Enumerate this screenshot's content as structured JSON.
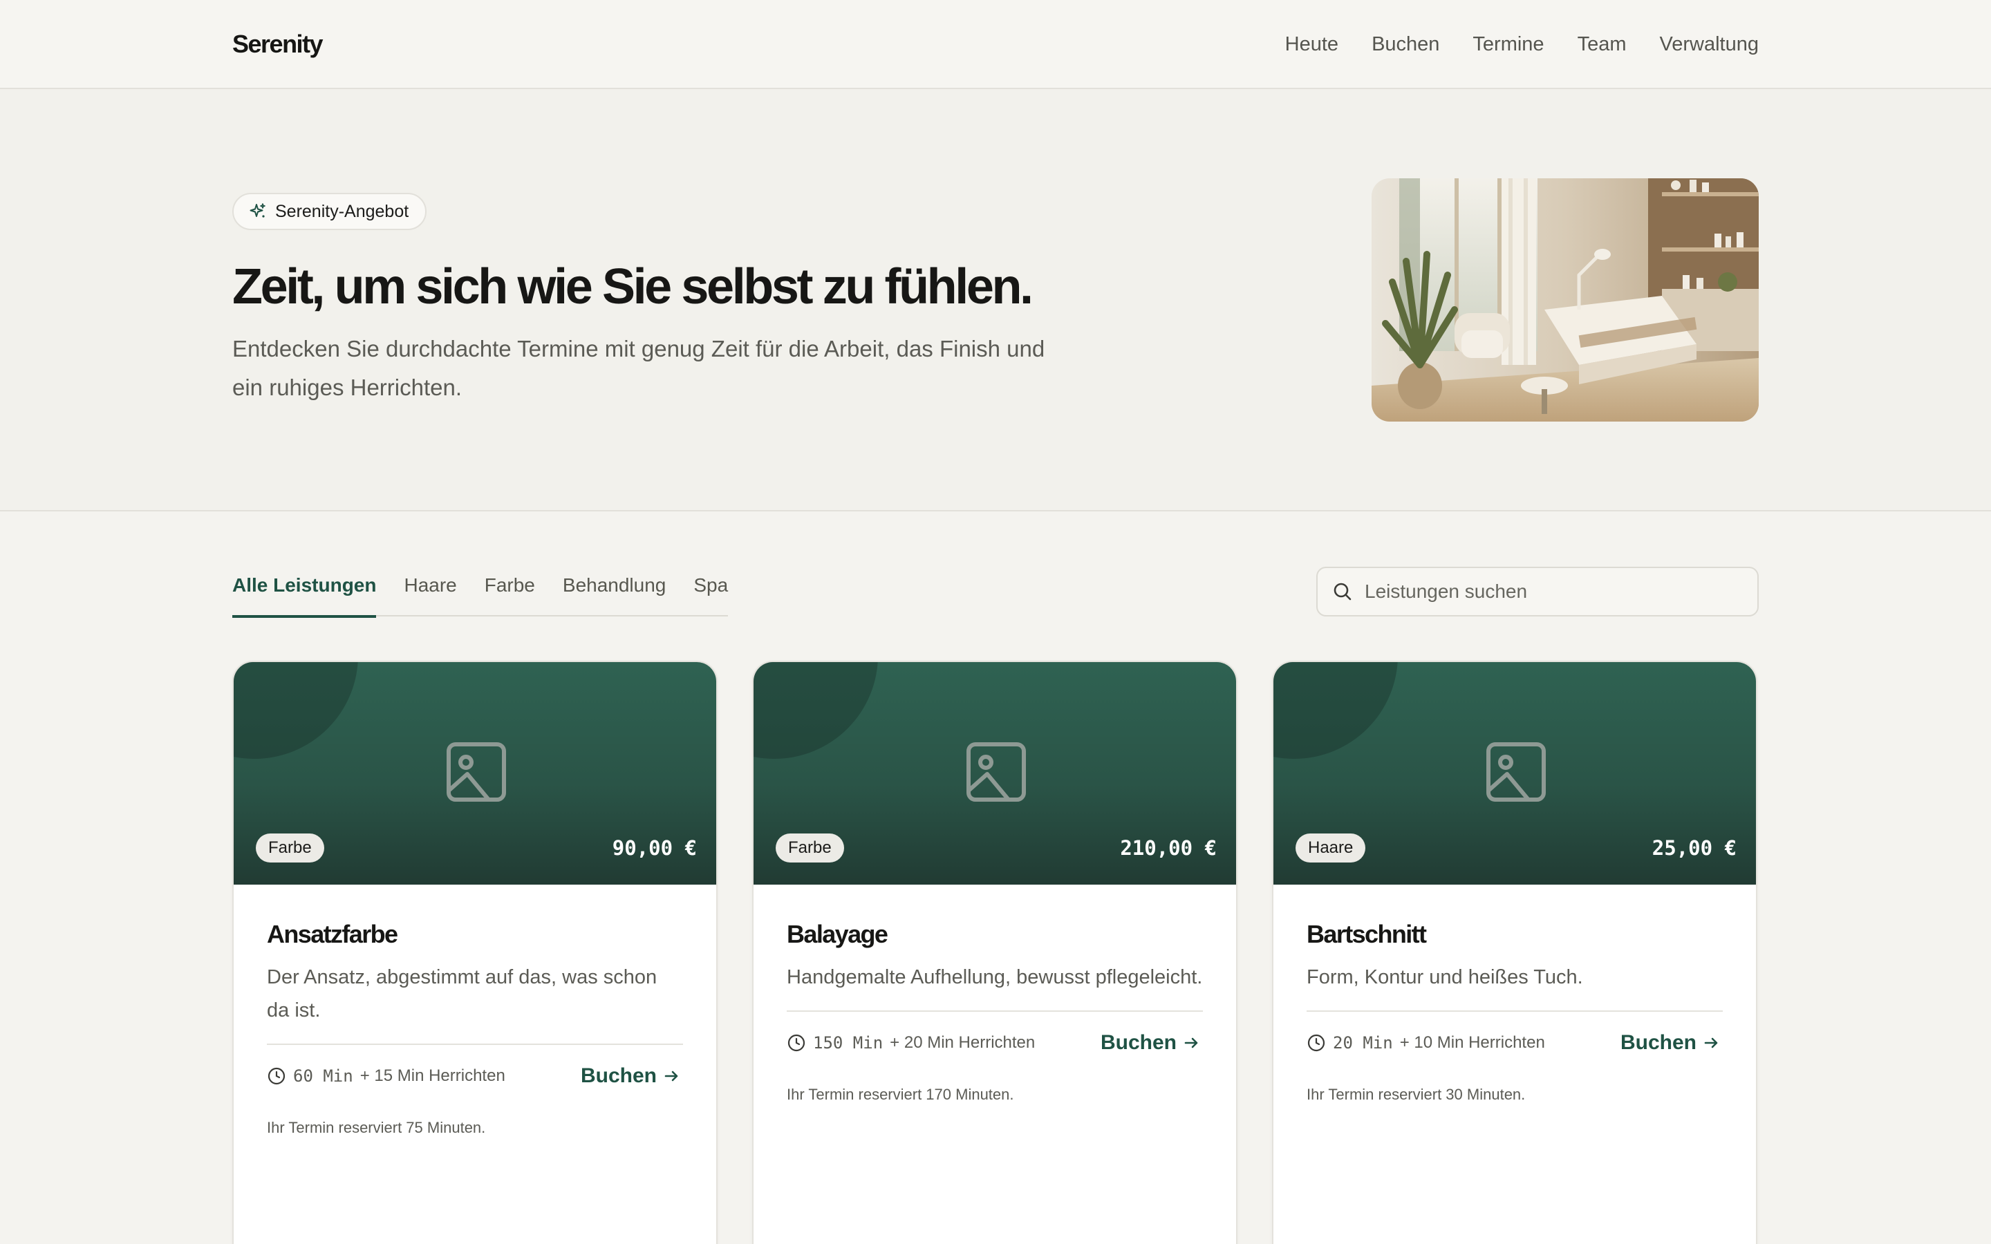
{
  "brand": "Serenity",
  "nav": [
    "Heute",
    "Buchen",
    "Termine",
    "Team",
    "Verwaltung"
  ],
  "hero": {
    "badge": "Serenity-Angebot",
    "title": "Zeit, um sich wie Sie selbst zu fühlen.",
    "subtitle": "Entdecken Sie durchdachte Termine mit genug Zeit für die Arbeit, das Finish und ein ruhiges Herrichten.",
    "image": "spa-treatment-room-photo"
  },
  "tabs": [
    {
      "label": "Alle Leistungen",
      "active": true
    },
    {
      "label": "Haare",
      "active": false
    },
    {
      "label": "Farbe",
      "active": false
    },
    {
      "label": "Behandlung",
      "active": false
    },
    {
      "label": "Spa",
      "active": false
    }
  ],
  "search": {
    "placeholder": "Leistungen suchen",
    "value": ""
  },
  "services": [
    {
      "tag": "Farbe",
      "price": "90,00 €",
      "title": "Ansatzfarbe",
      "description": "Der Ansatz, abgestimmt auf das, was schon da ist.",
      "duration": "60 Min",
      "prep": "+ 15 Min Herrichten",
      "book": "Buchen",
      "note": "Ihr Termin reserviert 75 Minuten."
    },
    {
      "tag": "Farbe",
      "price": "210,00 €",
      "title": "Balayage",
      "description": "Handgemalte Aufhellung, bewusst pflegeleicht.",
      "duration": "150 Min",
      "prep": "+ 20 Min Herrichten",
      "book": "Buchen",
      "note": "Ihr Termin reserviert 170 Minuten."
    },
    {
      "tag": "Haare",
      "price": "25,00 €",
      "title": "Bartschnitt",
      "description": "Form, Kontur und heißes Tuch.",
      "duration": "20 Min",
      "prep": "+ 10 Min Herrichten",
      "book": "Buchen",
      "note": "Ihr Termin reserviert 30 Minuten."
    }
  ],
  "colors": {
    "accent": "#1f5244",
    "card_media_top": "#2f6252",
    "card_media_bottom": "#213b33",
    "page_background": "#f4f3ef"
  },
  "icons": {
    "badge": "sparkle-icon",
    "search": "search-icon",
    "placeholder": "image-placeholder-icon",
    "duration": "clock-icon",
    "book": "arrow-right-icon"
  }
}
